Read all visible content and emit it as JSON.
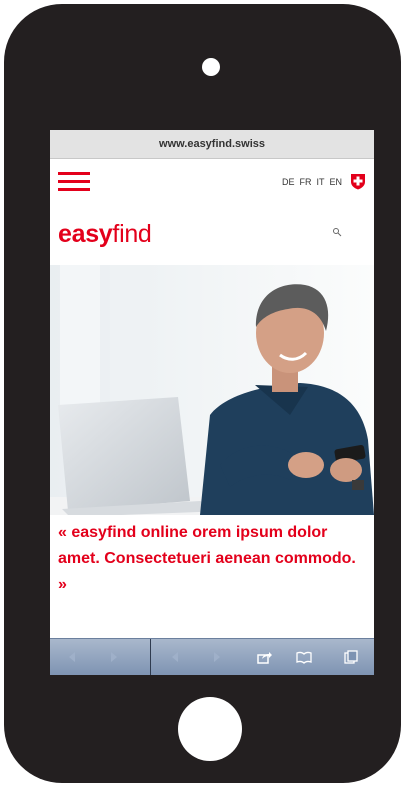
{
  "browser": {
    "url": "www.easyfind.swiss"
  },
  "header": {
    "languages": [
      "DE",
      "FR",
      "IT",
      "EN"
    ],
    "logo_bold": "easy",
    "logo_light": "find"
  },
  "hero": {
    "image": "man-smiling-with-smartphone-and-laptop"
  },
  "quote": {
    "open": "« ",
    "brand": "easyfind",
    "text": " online orem ipsum dolor amet. Consectetueri aenean commodo.",
    "close": " »"
  },
  "colors": {
    "accent": "#e3001b",
    "phone": "#231f20",
    "toolbar": "#8ea2bf"
  },
  "icons": [
    "menu-icon",
    "swiss-flag-icon",
    "search-icon",
    "back-icon",
    "forward-icon",
    "share-icon",
    "bookmarks-icon",
    "tabs-icon"
  ]
}
